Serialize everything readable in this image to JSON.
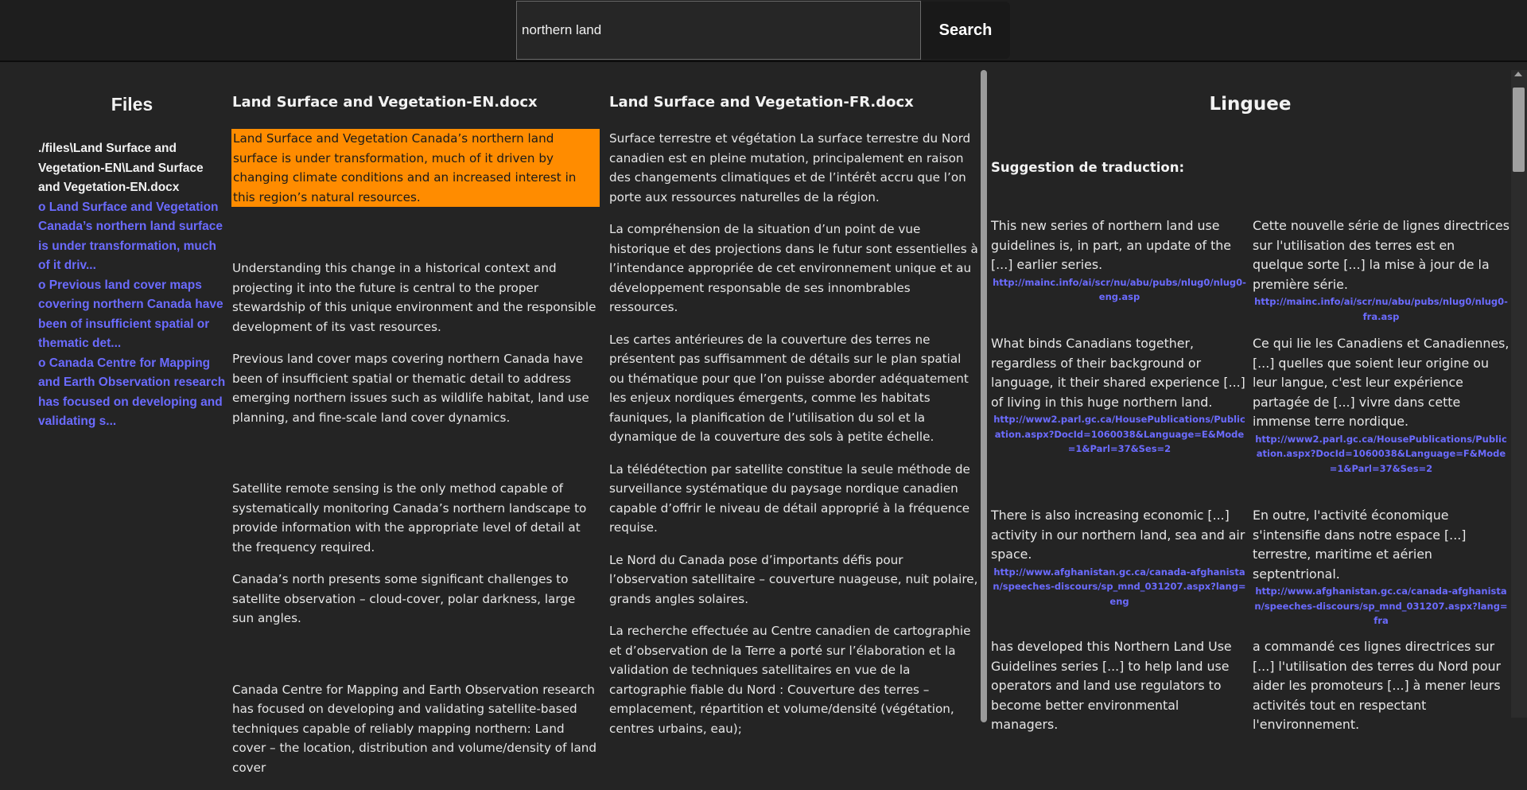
{
  "search": {
    "value": "northern land",
    "button_label": "Search"
  },
  "files": {
    "title": "Files",
    "path": "./files\\Land Surface and Vegetation-EN\\Land Surface and Vegetation-EN.docx",
    "links": [
      "o Land Surface and Vegetation Canada’s northern land surface is under transformation, much of it driv...",
      "o Previous land cover maps covering northern Canada have been of insufficient spatial or thematic det...",
      "o Canada Centre for Mapping and Earth Observation research has focused on developing and validating s..."
    ]
  },
  "english": {
    "title": "Land Surface and Vegetation-EN.docx",
    "paragraphs": [
      "Land Surface and Vegetation Canada’s northern land surface is under transformation, much of it driven by changing climate conditions and an increased interest in this region’s natural resources.",
      "Understanding this change in a historical context and projecting it into the future is central to the proper stewardship of this unique environment and the responsible development of its vast resources.",
      "Previous land cover maps covering northern Canada have been of insufficient spatial or thematic detail to address emerging northern issues such as wildlife habitat, land use planning, and fine-scale land cover dynamics.",
      "Satellite remote sensing is the only method capable of systematically monitoring Canada’s northern landscape to provide information with the appropriate level of detail at the frequency required.",
      "Canada’s north presents some significant challenges to satellite observation – cloud-cover, polar darkness, large sun angles.",
      "Canada Centre for Mapping and Earth Observation research has focused on developing and validating satellite-based techniques capable of reliably mapping northern: Land cover – the location, distribution and volume/density of land cover"
    ]
  },
  "french": {
    "title": "Land Surface and Vegetation-FR.docx",
    "paragraphs": [
      "Surface terrestre et végétation La surface terrestre du Nord canadien est en pleine mutation, principalement en raison des changements climatiques et de l’intérêt accru que l’on porte aux ressources naturelles de la région.",
      "La compréhension de la situation d’un point de vue historique et des projections dans le futur sont essentielles à l’intendance appropriée de cet environnement unique et au développement responsable de ses innombrables ressources.",
      "Les cartes antérieures de la couverture des terres ne présentent pas suffisamment de détails sur le plan spatial ou thématique pour que l’on puisse aborder adéquatement les enjeux nordiques émergents, comme les habitats fauniques, la planification de l’utilisation du sol et la dynamique de la couverture des sols à petite échelle.",
      "La télédétection par satellite constitue la seule méthode de surveillance systématique du paysage nordique canadien capable d’offrir le niveau de détail approprié à la fréquence requise.",
      "Le Nord du Canada pose d’importants défis pour l’observation satellitaire – couverture nuageuse, nuit polaire, grands angles solaires.",
      "La recherche effectuée au Centre canadien de cartographie et d’observation de la Terre a porté sur l’élaboration et la validation de techniques satellitaires en vue de la cartographie fiable du Nord : Couverture des terres – emplacement, répartition et volume/densité (végétation, centres urbains, eau);"
    ]
  },
  "linguee": {
    "title": "Linguee",
    "suggestion_label": "Suggestion de traduction:",
    "pairs": [
      {
        "en": "This new series of northern land use guidelines is, in part, an update of the [...] earlier series.",
        "en_src": "http://mainc.info/ai/scr/nu/abu/pubs/nlug0/nlug0-eng.asp",
        "fr": "Cette nouvelle série de lignes directrices sur l'utilisation des terres est en quelque sorte [...] la mise à jour de la première série.",
        "fr_src": "http://mainc.info/ai/scr/nu/abu/pubs/nlug0/nlug0-fra.asp"
      },
      {
        "en": "What binds Canadians together, regardless of their background or language, it their shared experience [...] of living in this huge northern land.",
        "en_src": "http://www2.parl.gc.ca/HousePublications/Publication.aspx?DocId=1060038&Language=E&Mode=1&Parl=37&Ses=2",
        "fr": "Ce qui lie les Canadiens et Canadiennes, [...] quelles que soient leur origine ou leur langue, c'est leur expérience partagée de [...] vivre dans cette immense terre nordique.",
        "fr_src": "http://www2.parl.gc.ca/HousePublications/Publication.aspx?DocId=1060038&Language=F&Mode=1&Parl=37&Ses=2"
      },
      {
        "en": "There is also increasing economic [...] activity in our northern land, sea and air space.",
        "en_src": "http://www.afghanistan.gc.ca/canada-afghanistan/speeches-discours/sp_mnd_031207.aspx?lang=eng",
        "fr": "En outre, l'activité économique s'intensifie dans notre espace [...] terrestre, maritime et aérien septentrional.",
        "fr_src": "http://www.afghanistan.gc.ca/canada-afghanistan/speeches-discours/sp_mnd_031207.aspx?lang=fra"
      },
      {
        "en": "has developed this Northern Land Use Guidelines series [...] to help land use operators and land use regulators to become better environmental managers.",
        "en_src": "",
        "fr": "a commandé ces lignes directrices sur [...] l'utilisation des terres du Nord pour aider les promoteurs [...] à mener leurs activités tout en respectant l'environnement.",
        "fr_src": ""
      }
    ]
  },
  "colors": {
    "background": "#242424",
    "highlight": "#ff8c00",
    "link": "#6b6bff"
  }
}
